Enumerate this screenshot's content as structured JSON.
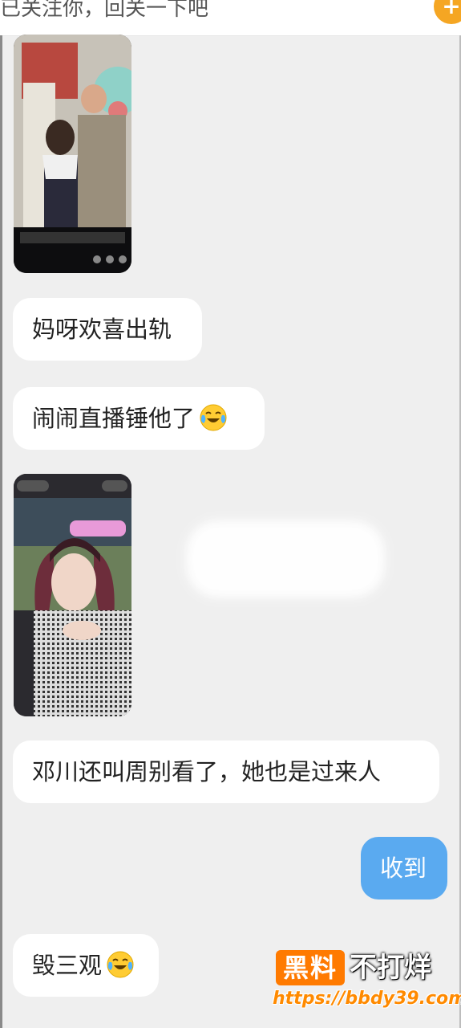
{
  "header": {
    "text": "已关注你，回关一下吧",
    "follow_icon": "plus-icon"
  },
  "messages": [
    {
      "type": "image",
      "subject": "video-screenshot"
    },
    {
      "type": "text",
      "text": "妈呀欢喜出轨"
    },
    {
      "type": "text",
      "text": "闹闹直播锤他了",
      "emoji": "crying-laughing-icon"
    },
    {
      "type": "image",
      "subject": "live-stream-screenshot"
    },
    {
      "type": "text",
      "text": "邓川还叫周别看了，她也是过来人"
    },
    {
      "type": "text",
      "text": "收到",
      "mine": true
    },
    {
      "type": "text",
      "text": "毁三观",
      "emoji": "crying-laughing-icon"
    }
  ],
  "watermark": {
    "badge": "黑料",
    "name": "不打烊",
    "url": "https://bbdy39.com"
  },
  "colors": {
    "background": "#efefef",
    "mine_bubble": "#5aaaf0",
    "accent": "#f5a623"
  }
}
